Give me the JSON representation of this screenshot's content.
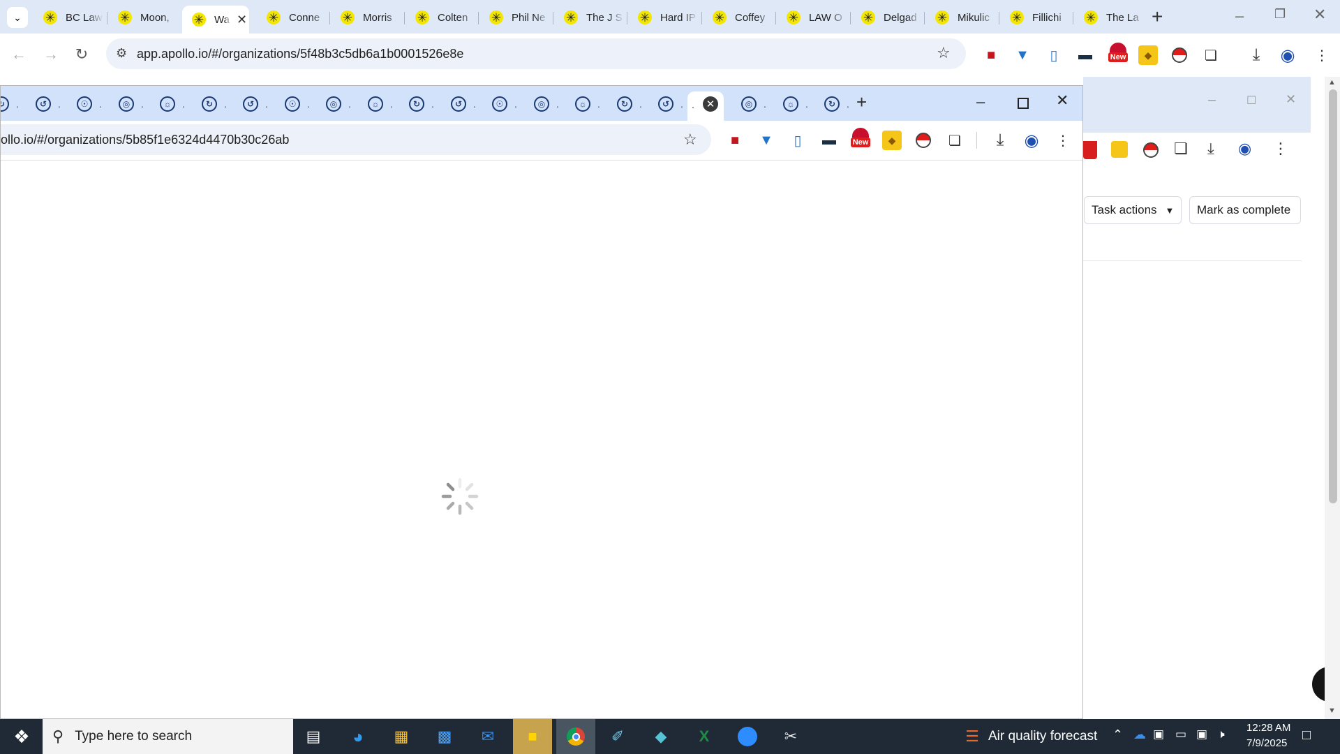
{
  "back_window": {
    "tabs": [
      {
        "title": "BC Law"
      },
      {
        "title": "Moon,"
      },
      {
        "title": "Wa",
        "active": true
      },
      {
        "title": "Conne"
      },
      {
        "title": "Morris"
      },
      {
        "title": "Colten"
      },
      {
        "title": "Phil Ne"
      },
      {
        "title": "The J S"
      },
      {
        "title": "Hard IP"
      },
      {
        "title": "Coffey"
      },
      {
        "title": "LAW O"
      },
      {
        "title": "Delgad"
      },
      {
        "title": "Mikulic"
      },
      {
        "title": "Fillichi"
      },
      {
        "title": "The La"
      }
    ],
    "url": "app.apollo.io/#/organizations/5f48b3c5db6a1b0001526e8e",
    "new_badge": "New",
    "task_actions_label": "Task actions",
    "mark_complete_label": "Mark as complete"
  },
  "front_window": {
    "url": "ollo.io/#/organizations/5b85f1e6324d4470b30c26ab",
    "new_badge": "New",
    "tab_count": 21
  },
  "taskbar": {
    "search_placeholder": "Type here to search",
    "weather": "Air quality forecast",
    "time": "12:28 AM",
    "date": "7/9/2025"
  },
  "colors": {
    "tabstrip_back": "#dfe8f7",
    "tabstrip_front": "#d3e2fb",
    "apollo_yellow": "#f3e600",
    "taskbar": "#1f2a36"
  }
}
